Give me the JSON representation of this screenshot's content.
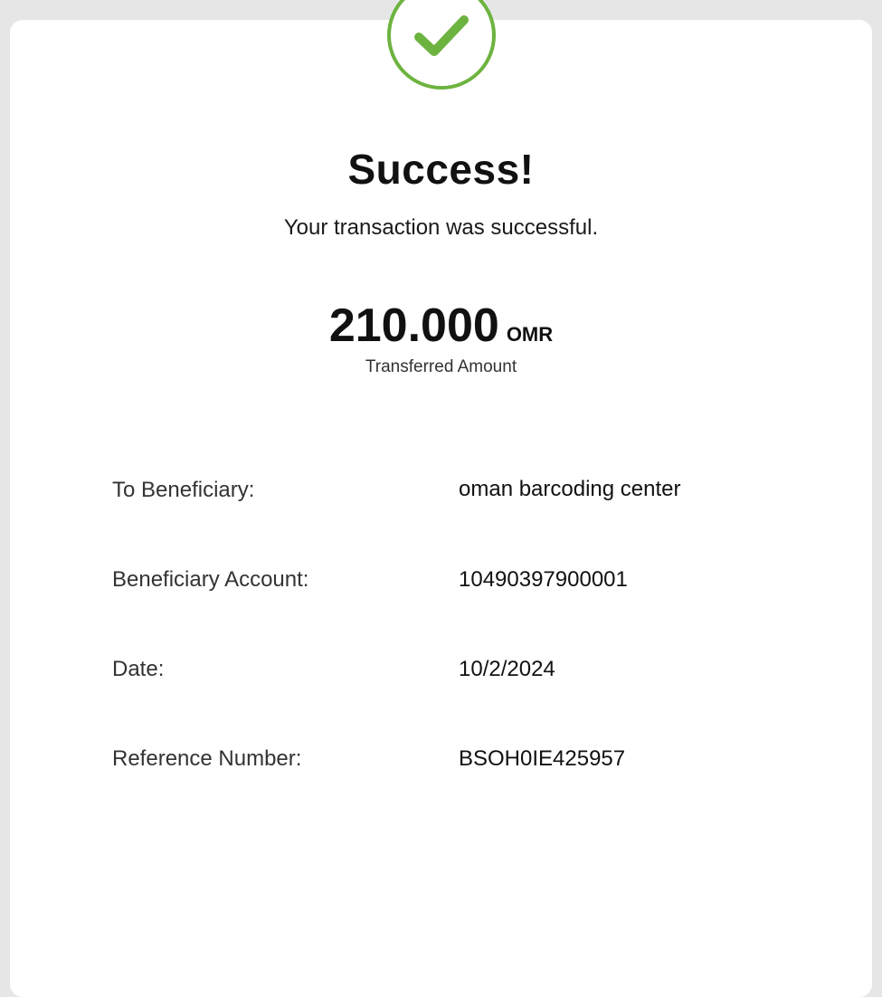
{
  "status": {
    "icon": "checkmark-icon",
    "accent_color": "#6db33f",
    "title": "Success!",
    "message": "Your transaction was successful."
  },
  "amount": {
    "value": "210.000",
    "currency": "OMR",
    "caption": "Transferred Amount"
  },
  "details": [
    {
      "label": "To Beneficiary:",
      "value": "oman barcoding center"
    },
    {
      "label": "Beneficiary Account:",
      "value": "10490397900001"
    },
    {
      "label": "Date:",
      "value": "10/2/2024"
    },
    {
      "label": "Reference Number:",
      "value": "BSOH0IE425957"
    }
  ]
}
